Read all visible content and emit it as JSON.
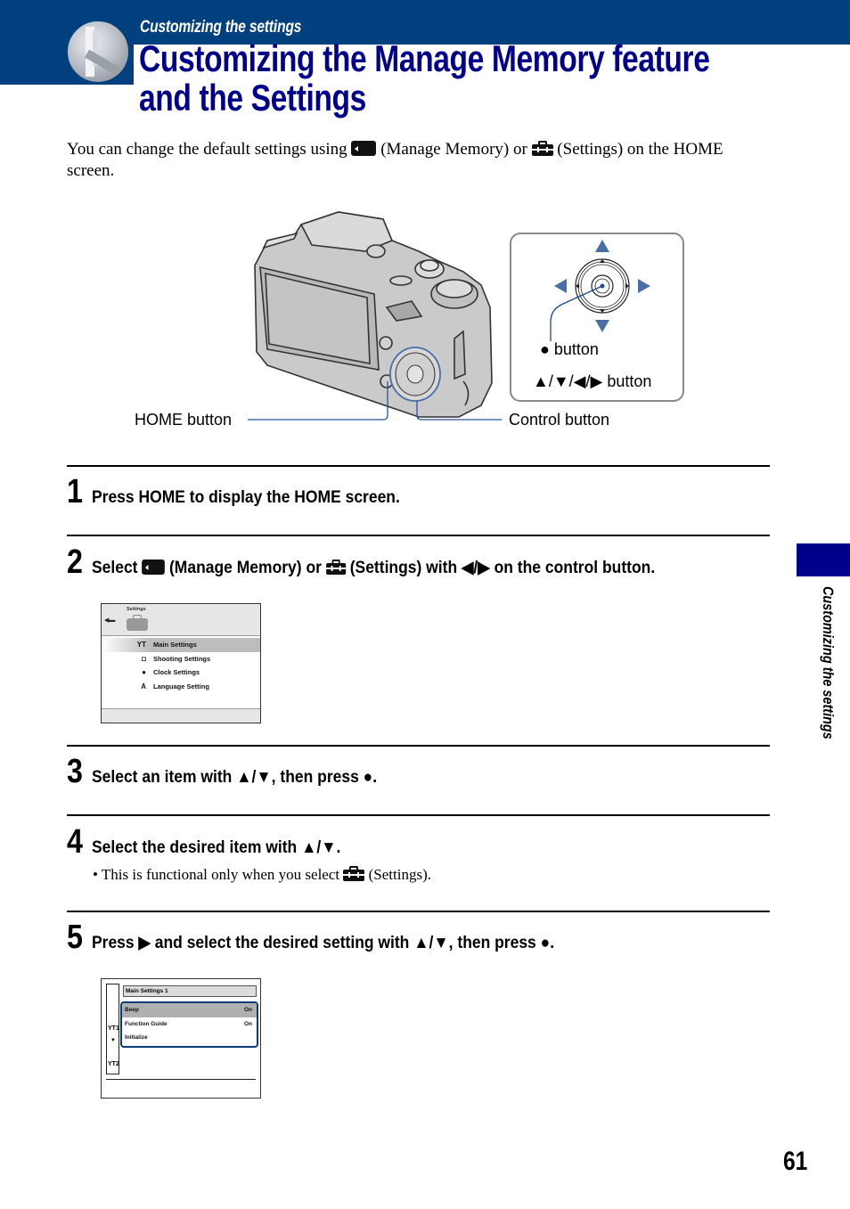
{
  "header": {
    "section_label": "Customizing the settings",
    "title_line1": "Customizing the Manage Memory feature",
    "title_line2": "and the Settings",
    "colors": {
      "band": "#00407e",
      "title": "#00008b"
    }
  },
  "intro": {
    "part1": "You can change the default settings using ",
    "icon1_label": "(Manage Memory) or ",
    "icon2_label": "(Settings) on the HOME screen."
  },
  "figure": {
    "home_button_label": "HOME button",
    "control_button_label": "Control button",
    "center_button_label": "button",
    "arrows_button_label": "▲/▼/◀/▶ button",
    "arrow_color": "#4a6fa5"
  },
  "steps": [
    {
      "num": "1",
      "text": "Press HOME to display the HOME screen."
    },
    {
      "num": "2",
      "text_a": "Select ",
      "text_b": " (Manage Memory) or ",
      "text_c": " (Settings) with ◀/▶ on the control button."
    },
    {
      "num": "3",
      "text": "Select an item with ▲/▼, then press ●."
    },
    {
      "num": "4",
      "text": "Select the desired item with ▲/▼."
    },
    {
      "num": "5",
      "text": "Press ▶ and select the desired setting with ▲/▼, then press ●."
    }
  ],
  "note": {
    "text_a": "• This is functional only when you select ",
    "text_b": " (Settings)."
  },
  "screen1": {
    "title": "Settings",
    "items": [
      {
        "icon": "main-settings-icon",
        "glyph": "YT",
        "label": "Main Settings",
        "selected": true
      },
      {
        "icon": "camera-icon",
        "glyph": "◘",
        "label": "Shooting Settings",
        "selected": false
      },
      {
        "icon": "clock-icon",
        "glyph": "●",
        "label": "Clock Settings",
        "selected": false
      },
      {
        "icon": "language-icon",
        "glyph": "A",
        "label": "Language Setting",
        "selected": false
      }
    ]
  },
  "screen2": {
    "header": "Main Settings 1",
    "tab1": "YT1",
    "tab2": "YT2",
    "rows": [
      {
        "label": "Beep",
        "value": "On",
        "selected": true
      },
      {
        "label": "Function Guide",
        "value": "On",
        "selected": false
      },
      {
        "label": "Initialize",
        "value": "",
        "selected": false
      }
    ]
  },
  "sidebar": {
    "section_text": "Customizing the settings"
  },
  "page_number": "61"
}
